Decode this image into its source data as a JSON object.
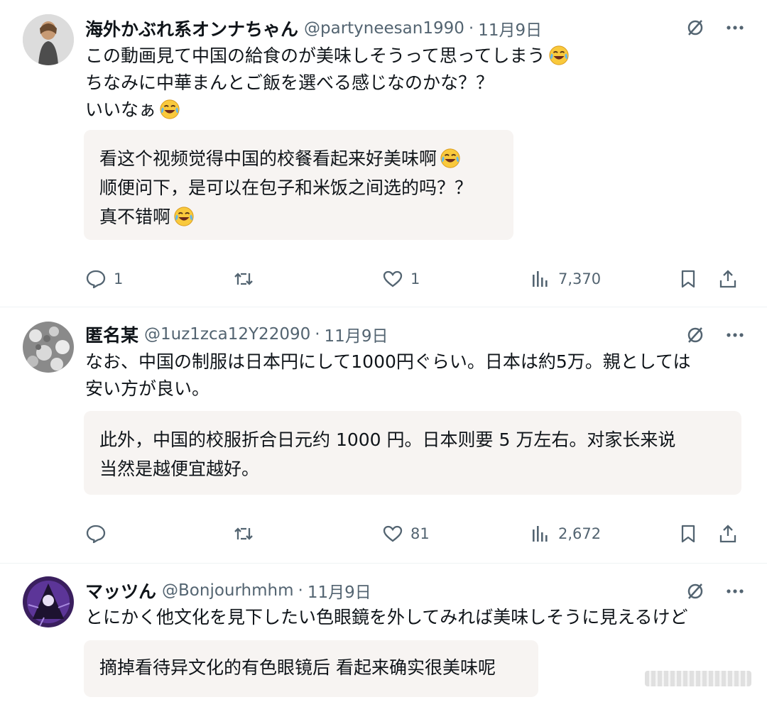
{
  "icons": {
    "reply": "speech-bubble-icon",
    "repost": "repost-arrows-icon",
    "like": "heart-icon",
    "views": "bar-chart-icon",
    "bookmark": "bookmark-icon",
    "share": "share-upload-icon",
    "grok": "slashed-circle-icon",
    "more": "more-dots-icon",
    "emoji": "tears-of-joy-emoji"
  },
  "colors": {
    "text": "#0f1419",
    "secondary": "#536471",
    "translation_bg": "#f7f4f2"
  },
  "tweets": [
    {
      "author": "海外かぶれ系オンナちゃん",
      "handle": "@partyneesan1990",
      "separator": "·",
      "date": "11月9日",
      "text_lines": [
        "この動画見て中国の給食のが美味しそうって思ってしまう",
        "ちなみに中華まんとご飯を選べる感じなのかな？？",
        "いいなぁ"
      ],
      "translation_lines": [
        "看这个视频觉得中国的校餐看起来好美味啊",
        "顺便问下，是可以在包子和米饭之间选的吗？？",
        "真不错啊"
      ],
      "replies": "1",
      "reposts": "",
      "likes": "1",
      "views": "7,370"
    },
    {
      "author": "匿名某",
      "handle": "@1uz1zca12Y22090",
      "separator": "·",
      "date": "11月9日",
      "text_lines": [
        "なお、中国の制服は日本円にして1000円ぐらい。日本は約5万。親としては",
        "安い方が良い。"
      ],
      "translation_lines": [
        "此外，中国的校服折合日元约 1000 円。日本则要 5 万左右。对家长来说",
        "当然是越便宜越好。"
      ],
      "replies": "",
      "reposts": "",
      "likes": "81",
      "views": "2,672"
    },
    {
      "author": "マッツん",
      "handle": "@Bonjourhmhm",
      "separator": "·",
      "date": "11月9日",
      "text_lines": [
        "とにかく他文化を見下したい色眼鏡を外してみれば美味しそうに見えるけど"
      ],
      "translation_lines": [
        "摘掉看待异文化的有色眼镜后 看起来确实很美味呢"
      ]
    }
  ]
}
